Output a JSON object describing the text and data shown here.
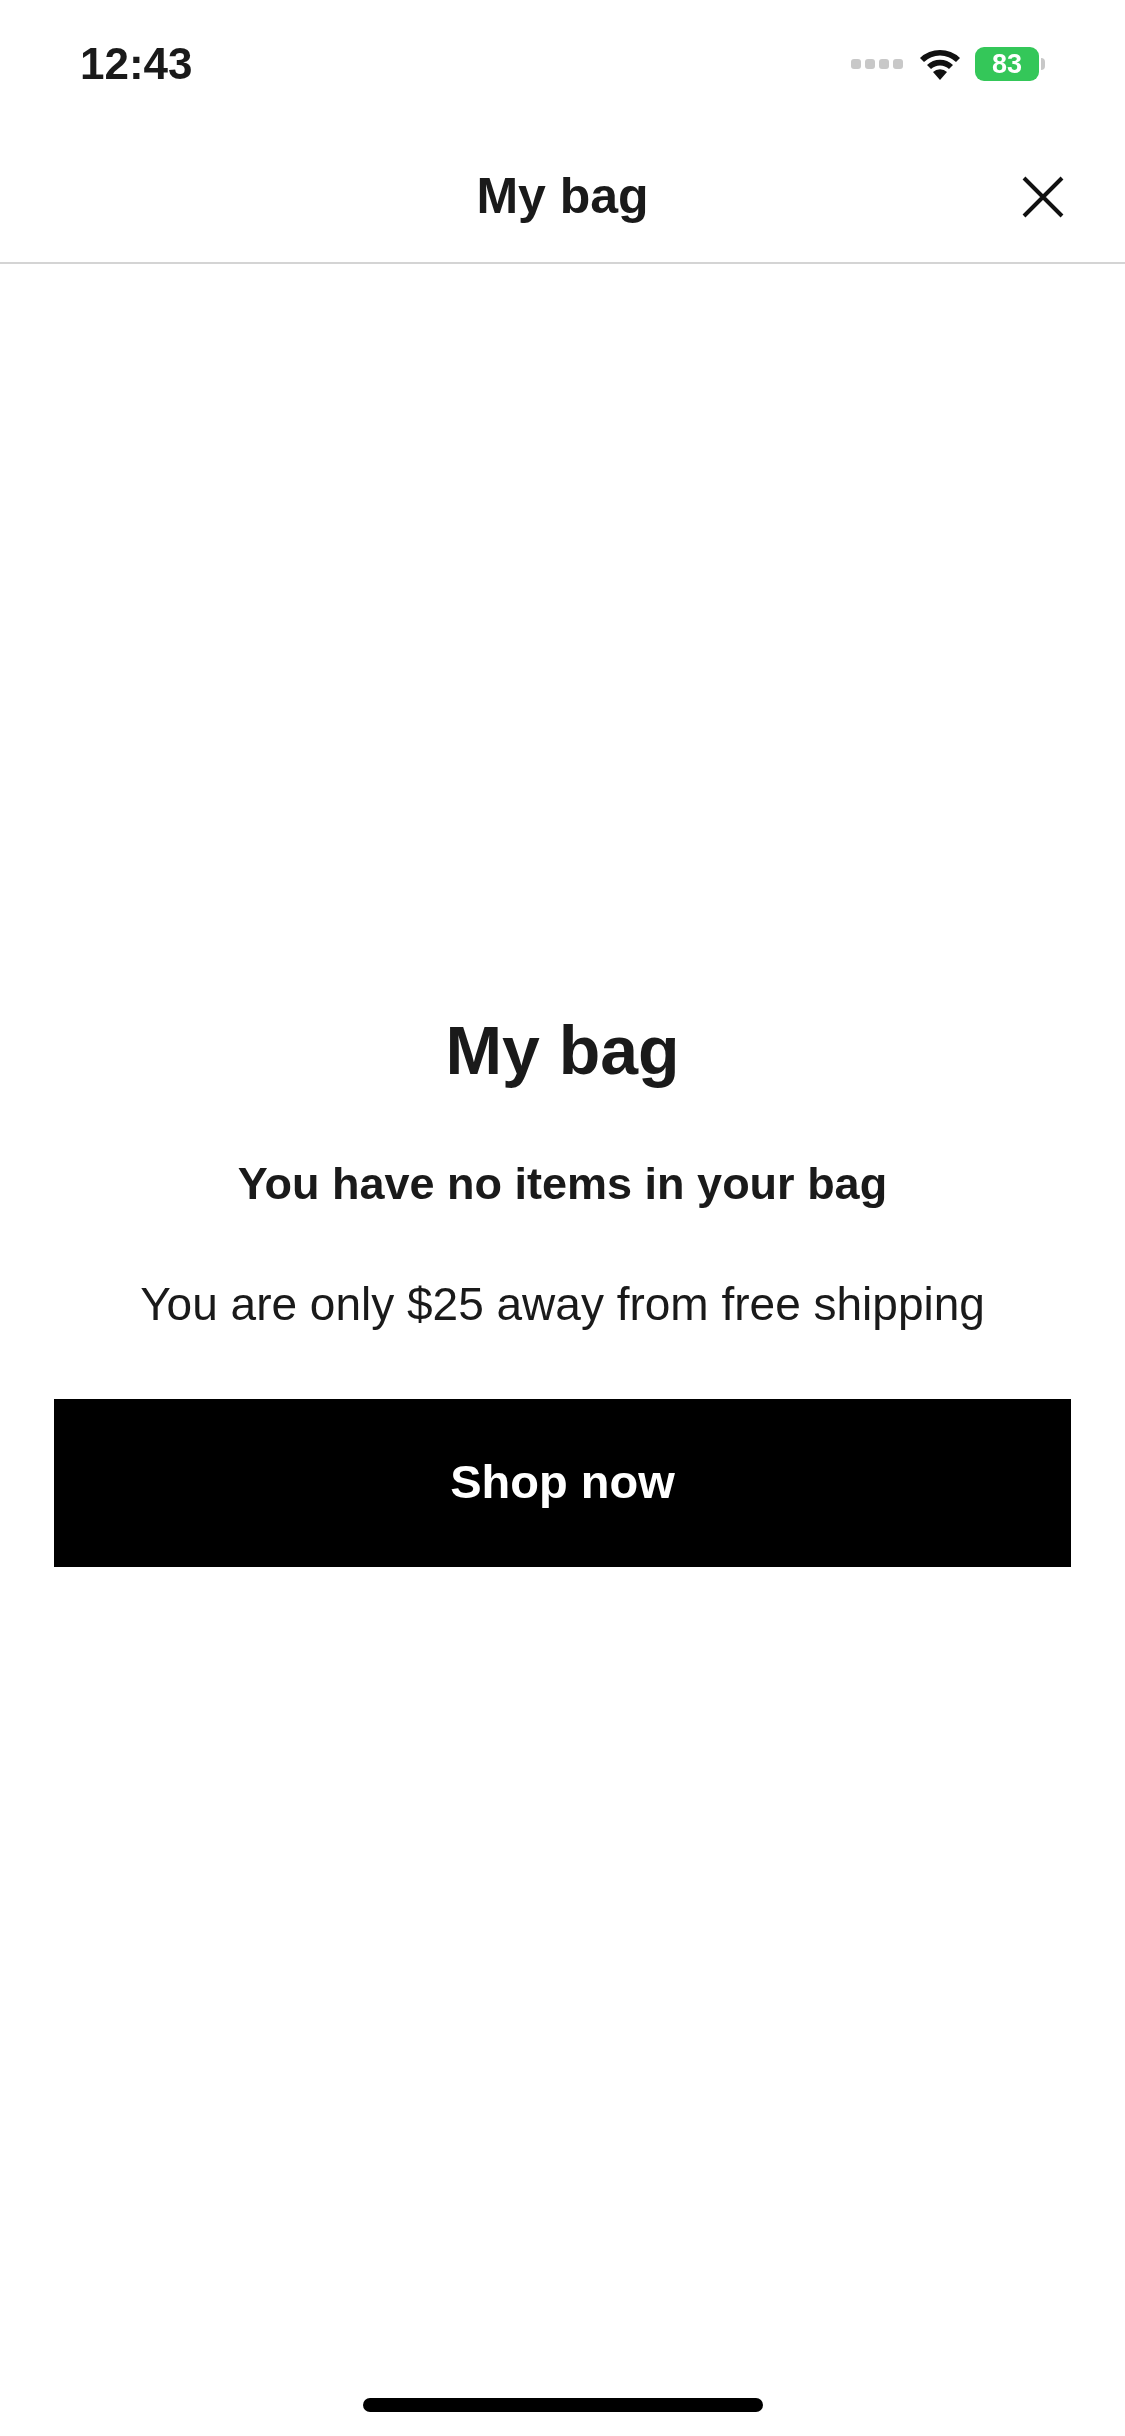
{
  "status_bar": {
    "time": "12:43",
    "battery": "83"
  },
  "header": {
    "title": "My bag"
  },
  "empty_state": {
    "title": "My bag",
    "message": "You have no items in your bag",
    "shipping_note": "You are only $25 away from free shipping"
  },
  "button": {
    "label": "Shop now"
  }
}
